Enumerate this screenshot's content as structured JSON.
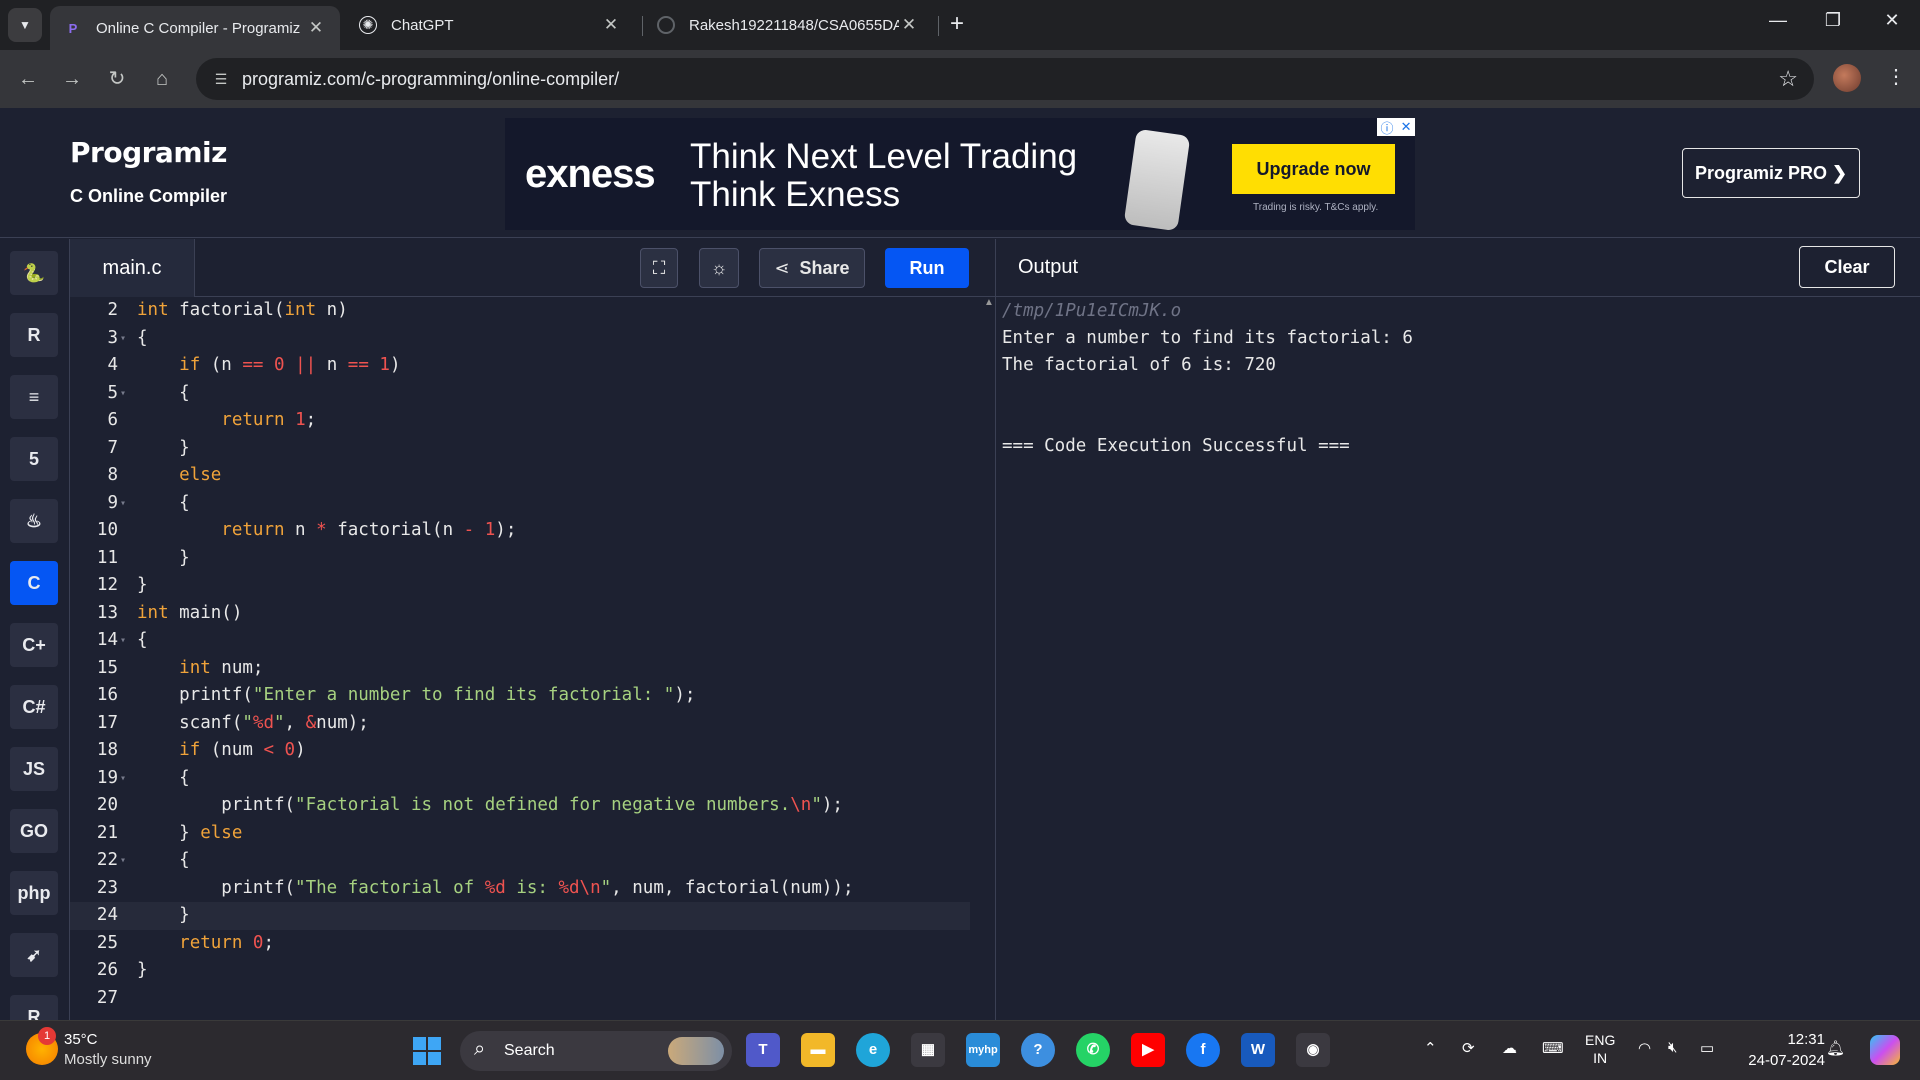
{
  "browser": {
    "tabs": [
      {
        "title": "Online C Compiler - Programiz",
        "active": true
      },
      {
        "title": "ChatGPT",
        "active": false
      },
      {
        "title": "Rakesh192211848/CSA0655DA/",
        "active": false
      }
    ],
    "url": "programiz.com/c-programming/online-compiler/"
  },
  "site": {
    "brand": "Programiz",
    "subtitle": "C Online Compiler",
    "pro_button": "Programiz PRO ❯",
    "ad": {
      "logo": "exness",
      "headline_1": "Think Next Level Trading",
      "headline_2": "Think Exness",
      "cta": "Upgrade now",
      "disclaimer": "Trading is risky. T&Cs apply."
    }
  },
  "rail": {
    "languages": [
      {
        "name": "python-icon",
        "glyph": "🐍"
      },
      {
        "name": "r-icon",
        "glyph": "R"
      },
      {
        "name": "sql-icon",
        "glyph": "≡"
      },
      {
        "name": "html-icon",
        "glyph": "5"
      },
      {
        "name": "java-icon",
        "glyph": "♨"
      },
      {
        "name": "c-icon",
        "glyph": "C"
      },
      {
        "name": "cpp-icon",
        "glyph": "C+"
      },
      {
        "name": "csharp-icon",
        "glyph": "C#"
      },
      {
        "name": "js-icon",
        "glyph": "JS"
      },
      {
        "name": "go-icon",
        "glyph": "GO"
      },
      {
        "name": "php-icon",
        "glyph": "php"
      },
      {
        "name": "swift-icon",
        "glyph": "➹"
      },
      {
        "name": "rust-icon",
        "glyph": "R"
      }
    ]
  },
  "editor": {
    "filename": "main.c",
    "share_label": "Share",
    "run_label": "Run",
    "lines": [
      {
        "n": "2",
        "fold": "",
        "html": "<span class=\"k\">int</span> factorial(<span class=\"k\">int</span> n)"
      },
      {
        "n": "3",
        "fold": "▾",
        "html": "{"
      },
      {
        "n": "4",
        "fold": "",
        "html": "    <span class=\"k\">if</span> (n <span class=\"o\">==</span> <span class=\"n\">0</span> <span class=\"o\">||</span> n <span class=\"o\">==</span> <span class=\"n\">1</span>)"
      },
      {
        "n": "5",
        "fold": "▾",
        "html": "    {"
      },
      {
        "n": "6",
        "fold": "",
        "html": "        <span class=\"k\">return</span> <span class=\"n\">1</span>;"
      },
      {
        "n": "7",
        "fold": "",
        "html": "    }"
      },
      {
        "n": "8",
        "fold": "",
        "html": "    <span class=\"k\">else</span>"
      },
      {
        "n": "9",
        "fold": "▾",
        "html": "    {"
      },
      {
        "n": "10",
        "fold": "",
        "html": "        <span class=\"k\">return</span> n <span class=\"o\">*</span> factorial(n <span class=\"o\">-</span> <span class=\"n\">1</span>);"
      },
      {
        "n": "11",
        "fold": "",
        "html": "    }"
      },
      {
        "n": "12",
        "fold": "",
        "html": "}"
      },
      {
        "n": "13",
        "fold": "",
        "html": "<span class=\"k\">int</span> main()"
      },
      {
        "n": "14",
        "fold": "▾",
        "html": "{"
      },
      {
        "n": "15",
        "fold": "",
        "html": "    <span class=\"k\">int</span> num;"
      },
      {
        "n": "16",
        "fold": "",
        "html": "    printf(<span class=\"s\">\"Enter a number to find its factorial: \"</span>);"
      },
      {
        "n": "17",
        "fold": "",
        "html": "    scanf(<span class=\"s\">\"</span><span class=\"n\">%d</span><span class=\"s\">\"</span>, <span class=\"o\">&amp;</span>num);"
      },
      {
        "n": "18",
        "fold": "",
        "html": "    <span class=\"k\">if</span> (num <span class=\"o\">&lt;</span> <span class=\"n\">0</span>)"
      },
      {
        "n": "19",
        "fold": "▾",
        "html": "    {"
      },
      {
        "n": "20",
        "fold": "",
        "html": "        printf(<span class=\"s\">\"Factorial is not defined for negative numbers.</span><span class=\"n\">\\n</span><span class=\"s\">\"</span>);"
      },
      {
        "n": "21",
        "fold": "",
        "html": "    } <span class=\"k\">else</span>"
      },
      {
        "n": "22",
        "fold": "▾",
        "html": "    {"
      },
      {
        "n": "23",
        "fold": "",
        "html": "        printf(<span class=\"s\">\"The factorial of </span><span class=\"n\">%d</span><span class=\"s\"> is: </span><span class=\"n\">%d\\n</span><span class=\"s\">\"</span>, num, factorial(num));"
      },
      {
        "n": "24",
        "fold": "",
        "html": "    }",
        "current": true
      },
      {
        "n": "25",
        "fold": "",
        "html": "    <span class=\"k\">return</span> <span class=\"n\">0</span>;"
      },
      {
        "n": "26",
        "fold": "",
        "html": "}"
      },
      {
        "n": "27",
        "fold": "",
        "html": ""
      }
    ]
  },
  "output": {
    "title": "Output",
    "clear_label": "Clear",
    "path": "/tmp/1Pu1eICmJK.o",
    "lines": [
      "Enter a number to find its factorial: 6",
      "The factorial of 6 is: 720",
      "",
      "",
      "=== Code Execution Successful ==="
    ]
  },
  "taskbar": {
    "weather_temp": "35°C",
    "weather_desc": "Mostly sunny",
    "weather_badge": "1",
    "search_label": "Search",
    "lang_1": "ENG",
    "lang_2": "IN",
    "time": "12:31",
    "date": "24-07-2024"
  }
}
